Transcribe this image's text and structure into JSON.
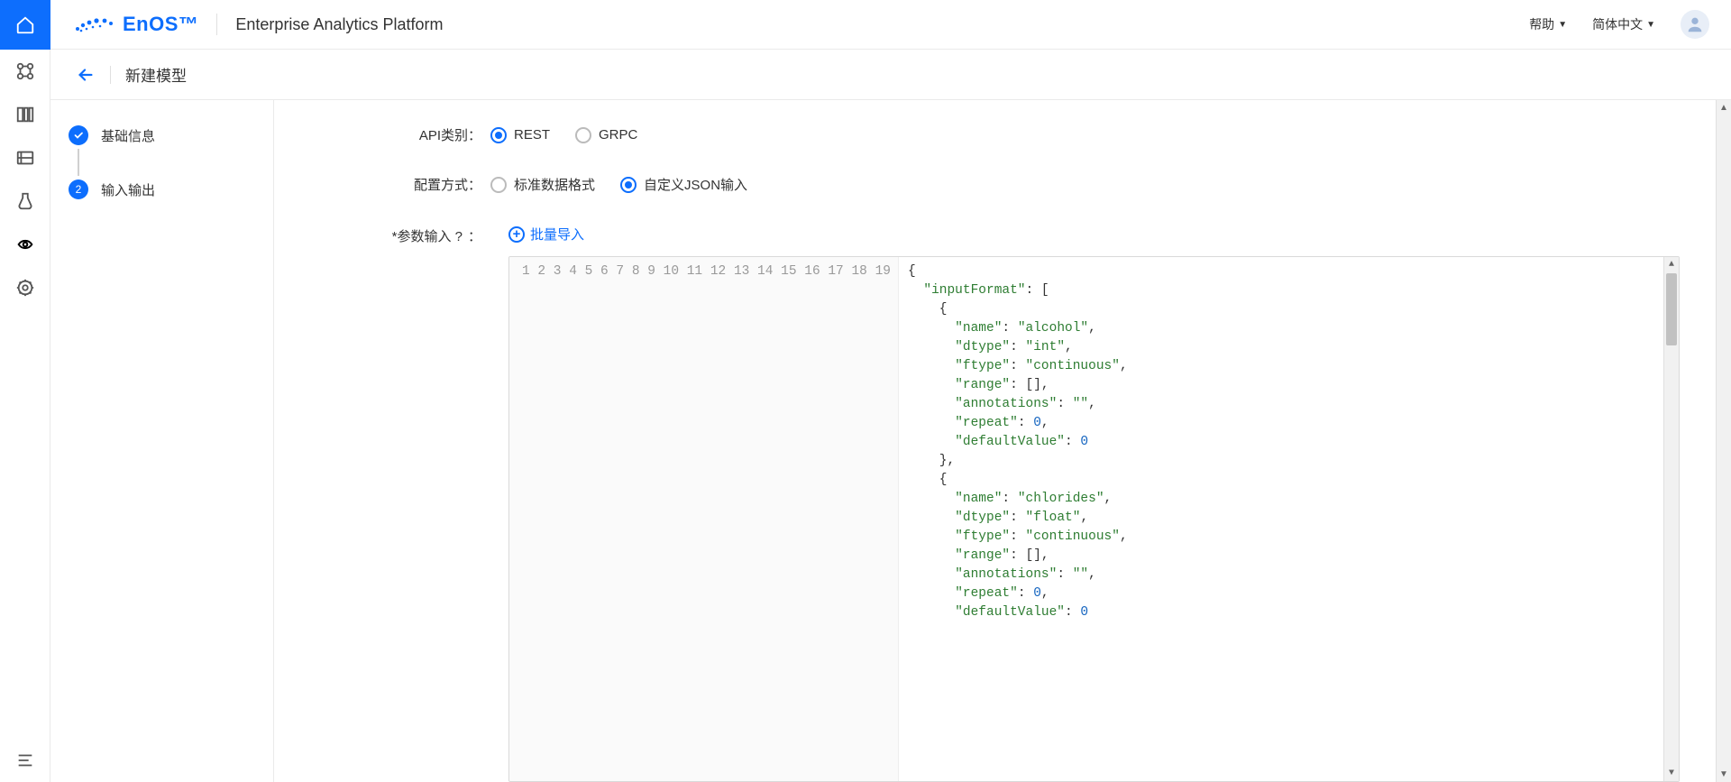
{
  "brand": {
    "name": "EnOS™",
    "product": "Enterprise Analytics Platform"
  },
  "topnav": {
    "help": "帮助",
    "lang": "简体中文"
  },
  "page": {
    "title": "新建模型"
  },
  "steps": [
    {
      "label": "基础信息",
      "done": true
    },
    {
      "label": "输入输出",
      "num": "2"
    }
  ],
  "form": {
    "api_label": "API类别：",
    "api_options": {
      "rest": "REST",
      "grpc": "GRPC"
    },
    "api_selected": "rest",
    "config_label": "配置方式：",
    "config_options": {
      "std": "标准数据格式",
      "custom": "自定义JSON输入"
    },
    "config_selected": "custom",
    "param_label": "参数输入",
    "param_colon": "：",
    "batch_import": "批量导入"
  },
  "code_lines": [
    [
      [
        "pun",
        "{"
      ]
    ],
    [
      [
        "pun",
        "  "
      ],
      [
        "key",
        "\"inputFormat\""
      ],
      [
        "pun",
        ": ["
      ]
    ],
    [
      [
        "pun",
        "    {"
      ]
    ],
    [
      [
        "pun",
        "      "
      ],
      [
        "key",
        "\"name\""
      ],
      [
        "pun",
        ": "
      ],
      [
        "str",
        "\"alcohol\""
      ],
      [
        "pun",
        ","
      ]
    ],
    [
      [
        "pun",
        "      "
      ],
      [
        "key",
        "\"dtype\""
      ],
      [
        "pun",
        ": "
      ],
      [
        "str",
        "\"int\""
      ],
      [
        "pun",
        ","
      ]
    ],
    [
      [
        "pun",
        "      "
      ],
      [
        "key",
        "\"ftype\""
      ],
      [
        "pun",
        ": "
      ],
      [
        "str",
        "\"continuous\""
      ],
      [
        "pun",
        ","
      ]
    ],
    [
      [
        "pun",
        "      "
      ],
      [
        "key",
        "\"range\""
      ],
      [
        "pun",
        ": [],"
      ]
    ],
    [
      [
        "pun",
        "      "
      ],
      [
        "key",
        "\"annotations\""
      ],
      [
        "pun",
        ": "
      ],
      [
        "str",
        "\"\""
      ],
      [
        "pun",
        ","
      ]
    ],
    [
      [
        "pun",
        "      "
      ],
      [
        "key",
        "\"repeat\""
      ],
      [
        "pun",
        ": "
      ],
      [
        "num",
        "0"
      ],
      [
        "pun",
        ","
      ]
    ],
    [
      [
        "pun",
        "      "
      ],
      [
        "key",
        "\"defaultValue\""
      ],
      [
        "pun",
        ": "
      ],
      [
        "num",
        "0"
      ]
    ],
    [
      [
        "pun",
        "    },"
      ]
    ],
    [
      [
        "pun",
        "    {"
      ]
    ],
    [
      [
        "pun",
        "      "
      ],
      [
        "key",
        "\"name\""
      ],
      [
        "pun",
        ": "
      ],
      [
        "str",
        "\"chlorides\""
      ],
      [
        "pun",
        ","
      ]
    ],
    [
      [
        "pun",
        "      "
      ],
      [
        "key",
        "\"dtype\""
      ],
      [
        "pun",
        ": "
      ],
      [
        "str",
        "\"float\""
      ],
      [
        "pun",
        ","
      ]
    ],
    [
      [
        "pun",
        "      "
      ],
      [
        "key",
        "\"ftype\""
      ],
      [
        "pun",
        ": "
      ],
      [
        "str",
        "\"continuous\""
      ],
      [
        "pun",
        ","
      ]
    ],
    [
      [
        "pun",
        "      "
      ],
      [
        "key",
        "\"range\""
      ],
      [
        "pun",
        ": [],"
      ]
    ],
    [
      [
        "pun",
        "      "
      ],
      [
        "key",
        "\"annotations\""
      ],
      [
        "pun",
        ": "
      ],
      [
        "str",
        "\"\""
      ],
      [
        "pun",
        ","
      ]
    ],
    [
      [
        "pun",
        "      "
      ],
      [
        "key",
        "\"repeat\""
      ],
      [
        "pun",
        ": "
      ],
      [
        "num",
        "0"
      ],
      [
        "pun",
        ","
      ]
    ],
    [
      [
        "pun",
        "      "
      ],
      [
        "key",
        "\"defaultValue\""
      ],
      [
        "pun",
        ": "
      ],
      [
        "num",
        "0"
      ]
    ]
  ]
}
